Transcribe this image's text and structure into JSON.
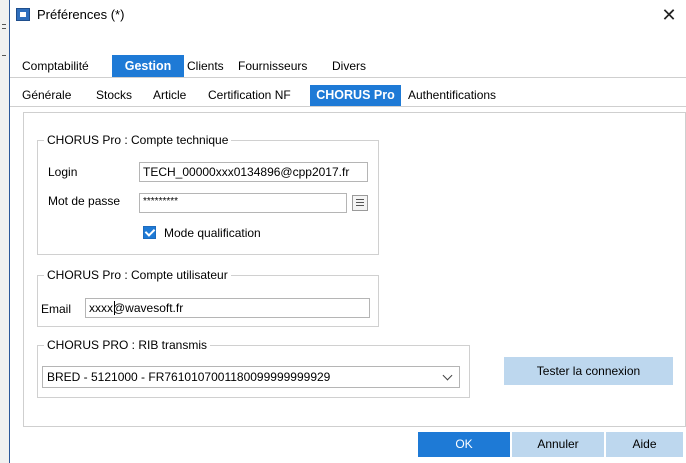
{
  "window": {
    "title": "Préférences (*)",
    "close_glyph": "✕",
    "app_icon": "app-icon"
  },
  "top_tabs": [
    {
      "label": "Comptabilité",
      "active": false
    },
    {
      "label": "Gestion",
      "active": true
    },
    {
      "label": "Clients",
      "active": false
    },
    {
      "label": "Fournisseurs",
      "active": false
    },
    {
      "label": "Divers",
      "active": false
    }
  ],
  "sub_tabs": [
    {
      "label": "Générale",
      "active": false
    },
    {
      "label": "Stocks",
      "active": false
    },
    {
      "label": "Article",
      "active": false
    },
    {
      "label": "Certification NF",
      "active": false
    },
    {
      "label": "CHORUS Pro",
      "active": true
    },
    {
      "label": "Authentifications",
      "active": false
    }
  ],
  "technical_account": {
    "title": "CHORUS Pro : Compte technique",
    "login_label": "Login",
    "login_value": "TECH_00000xxx0134896@cpp2017.fr",
    "password_label": "Mot de passe",
    "password_value": "*********",
    "qualification_label": "Mode qualification",
    "qualification_checked": true
  },
  "user_account": {
    "title": "CHORUS Pro : Compte utilisateur",
    "email_label": "Email",
    "email_value": "xxxx@wavesoft.fr"
  },
  "rib": {
    "title": "CHORUS PRO : RIB transmis",
    "selected": "BRED - 5121000 - FR7610107001180099999999929"
  },
  "buttons": {
    "test_connection": "Tester la connexion",
    "ok": "OK",
    "cancel": "Annuler",
    "help": "Aide"
  },
  "colors": {
    "accent": "#1e7ad6",
    "secondary_button": "#bdd7ee"
  }
}
